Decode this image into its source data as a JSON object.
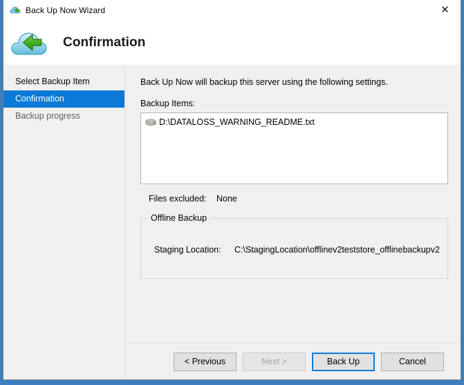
{
  "window": {
    "title": "Back Up Now Wizard",
    "title_icon": "cloud-backup-icon",
    "close_label": "✕"
  },
  "header": {
    "icon": "cloud-backup-icon",
    "title": "Confirmation"
  },
  "sidebar": {
    "items": [
      {
        "label": "Select Backup Item",
        "state": "done"
      },
      {
        "label": "Confirmation",
        "state": "active"
      },
      {
        "label": "Backup progress",
        "state": "pending"
      }
    ]
  },
  "content": {
    "intro": "Back Up Now will backup this server using the following settings.",
    "backup_items_label": "Backup Items:",
    "backup_items": [
      {
        "icon": "disk-drive-icon",
        "path": "D:\\DATALOSS_WARNING_README.txt"
      }
    ],
    "files_excluded_label": "Files excluded:",
    "files_excluded_value": "None",
    "offline_backup": {
      "group_title": "Offline Backup",
      "staging_label": "Staging Location:",
      "staging_value": "C:\\StagingLocation\\offlinev2teststore_offlinebackupv2"
    }
  },
  "footer": {
    "buttons": [
      {
        "label": "< Previous",
        "state": "enabled",
        "name": "previous-button"
      },
      {
        "label": "Next >",
        "state": "disabled",
        "name": "next-button"
      },
      {
        "label": "Back Up",
        "state": "default",
        "name": "back-up-button"
      },
      {
        "label": "Cancel",
        "state": "enabled",
        "name": "cancel-button"
      }
    ]
  },
  "colors": {
    "accent": "#0a7ad6",
    "window_bg": "#f0f0f0",
    "desktop": "#3c7ebf",
    "cloud": "#a9dced",
    "arrow": "#34a017"
  }
}
